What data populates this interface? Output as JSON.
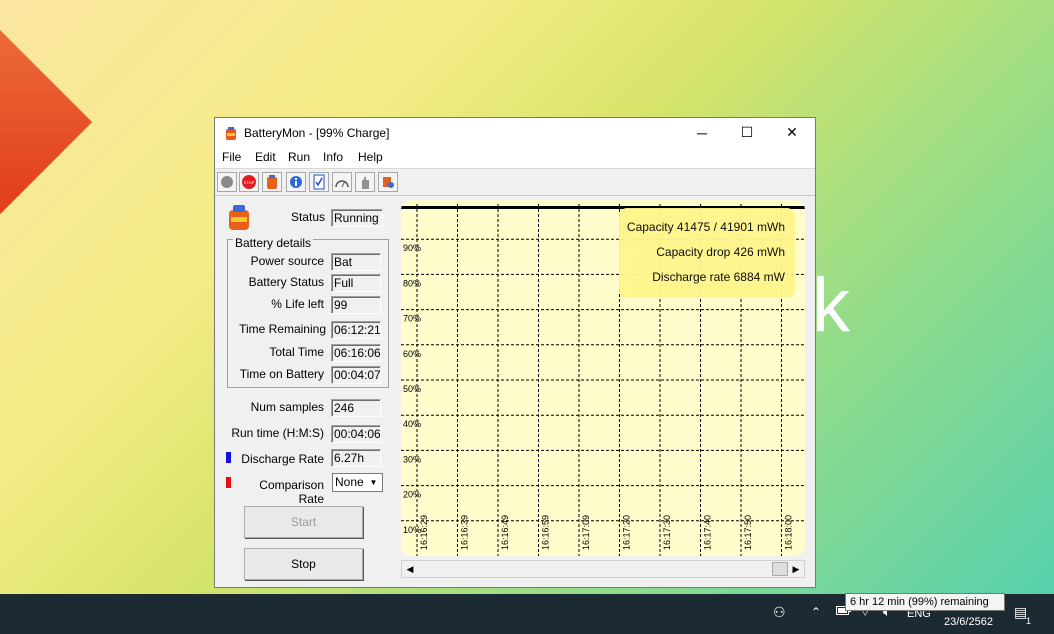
{
  "window": {
    "title": "BatteryMon - [99% Charge]",
    "minimize_glyph": "─",
    "maximize_glyph": "☐",
    "close_glyph": "✕"
  },
  "menu": [
    "File",
    "Edit",
    "Run",
    "Info",
    "Help"
  ],
  "toolbar": {
    "icons": [
      "circle-icon",
      "stop-icon",
      "battery-icon",
      "info-icon",
      "checklist-icon",
      "gauge-icon",
      "hand-icon",
      "settings-icon"
    ],
    "stop_text": "STOP"
  },
  "status": {
    "label": "Status",
    "value": "Running"
  },
  "battery_details": {
    "title": "Battery details",
    "rows": [
      {
        "label": "Power source",
        "value": "Bat"
      },
      {
        "label": "Battery Status",
        "value": "Full"
      },
      {
        "label": "% Life left",
        "value": "99"
      },
      {
        "label": "Time Remaining",
        "value": "06:12:21"
      },
      {
        "label": "Total Time",
        "value": "06:16:06"
      },
      {
        "label": "Time on Battery",
        "value": "00:04:07"
      }
    ]
  },
  "samples": {
    "num_label": "Num samples",
    "num_value": "246",
    "run_label": "Run time (H:M:S)",
    "run_value": "00:04:06",
    "discharge_label": "Discharge Rate",
    "discharge_value": "6.27h",
    "comparison_label": "Comparison Rate",
    "comparison_value": "None"
  },
  "colors": {
    "discharge": "#1010e0",
    "comparison": "#e01010",
    "chart_bg": "#fffdcc",
    "info_box": "#fff58c"
  },
  "buttons": {
    "start": "Start",
    "stop": "Stop"
  },
  "chart_info": {
    "capacity": "Capacity 41475 / 41901 mWh",
    "capacity_drop": "Capacity drop 426 mWh",
    "discharge_rate": "Discharge rate 6884 mW"
  },
  "chart_data": {
    "type": "line",
    "y_ticks": [
      "90%",
      "80%",
      "70%",
      "60%",
      "50%",
      "40%",
      "30%",
      "20%",
      "10%"
    ],
    "x_ticks": [
      "16:16:29",
      "16:16:39",
      "16:16:49",
      "16:16:59",
      "16:17:09",
      "16:17:20",
      "16:17:30",
      "16:17:40",
      "16:17:50",
      "16:18:00"
    ],
    "ylim": [
      0,
      100
    ],
    "grid": true,
    "series": [
      {
        "values": [
          99,
          99,
          99,
          99,
          99,
          99,
          99,
          99,
          99,
          99
        ]
      }
    ]
  },
  "taskbar": {
    "tooltip": "6 hr 12 min (99%) remaining",
    "lang": "ENG",
    "date": "23/6/2562",
    "notification_count": "1"
  },
  "wallpaper_text": "k"
}
